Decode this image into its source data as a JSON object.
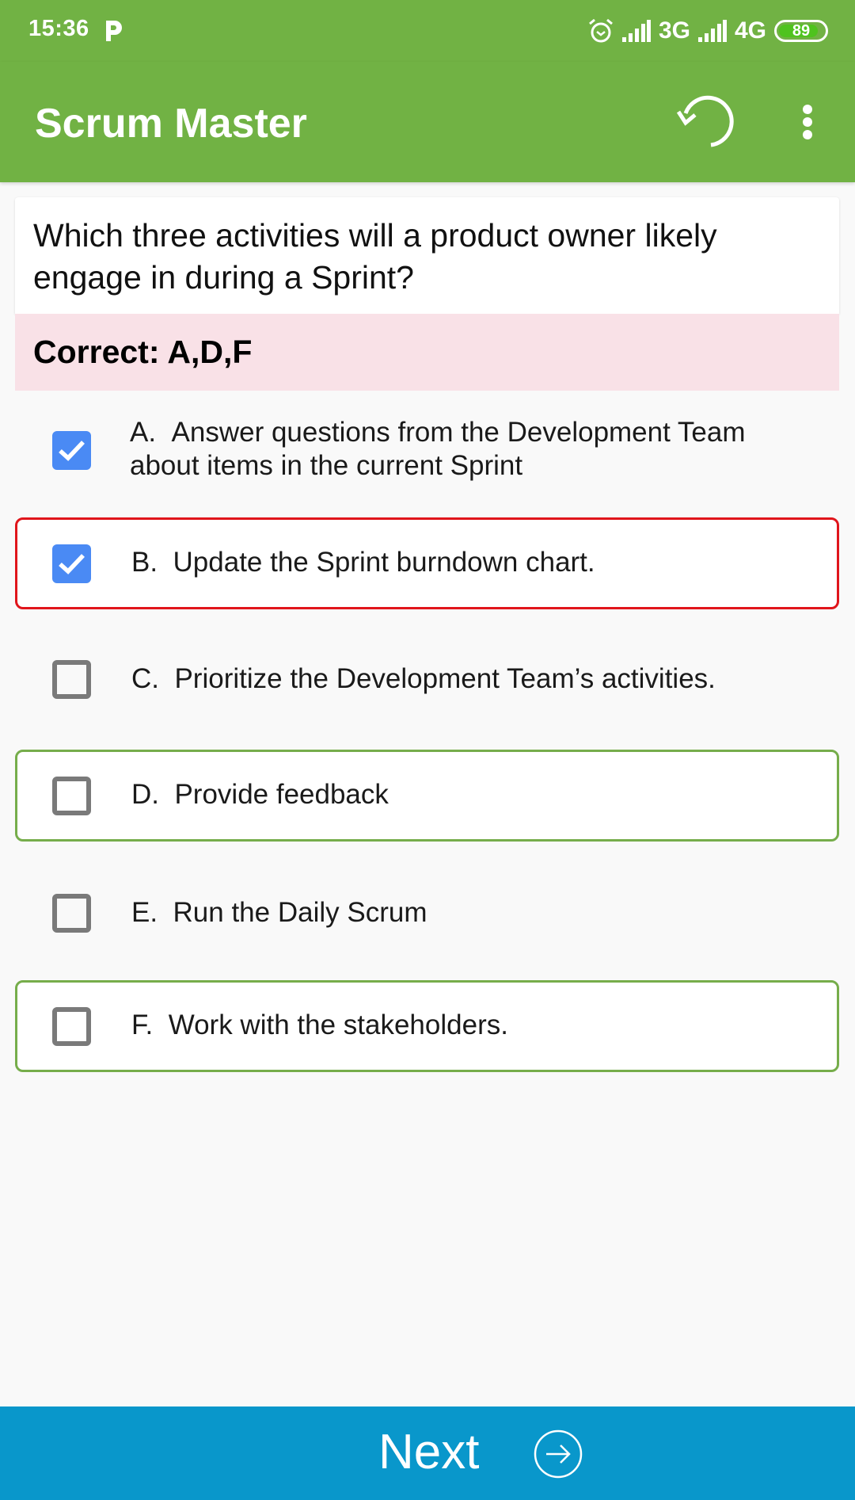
{
  "status_bar": {
    "time": "15:36",
    "notification_icon": "p-app-icon",
    "alarm_icon": "alarm-icon",
    "network_1": "3G",
    "network_2": "4G",
    "battery_level": "89",
    "battery_percent": 89
  },
  "app_bar": {
    "title": "Scrum Master",
    "refresh_icon": "refresh-icon",
    "menu_icon": "more-vert-icon"
  },
  "question": {
    "text": "Which three activities will a product owner likely engage in during a Sprint?",
    "correct_label": "Correct: A,D,F"
  },
  "options": [
    {
      "letter": "A.",
      "text": "Answer questions from the Development Team about items in the current Sprint",
      "checked": true,
      "status": "none"
    },
    {
      "letter": "B.",
      "text": "Update the Sprint burndown chart.",
      "checked": true,
      "status": "wrong"
    },
    {
      "letter": "C.",
      "text": "Prioritize the Development Team’s activities.",
      "checked": false,
      "status": "none"
    },
    {
      "letter": "D.",
      "text": "Provide feedback",
      "checked": false,
      "status": "correct"
    },
    {
      "letter": "E.",
      "text": "Run the Daily Scrum",
      "checked": false,
      "status": "none"
    },
    {
      "letter": "F.",
      "text": "Work with the stakeholders.",
      "checked": false,
      "status": "correct"
    }
  ],
  "footer": {
    "next_label": "Next",
    "next_icon": "arrow-circle-right-icon"
  },
  "colors": {
    "app_green": "#71b244",
    "wrong_red": "#e0151b",
    "correct_green": "#76ad4b",
    "checkbox_blue": "#4a8af4",
    "correct_band_pink": "#f9e1e7",
    "next_blue": "#0997cb"
  }
}
